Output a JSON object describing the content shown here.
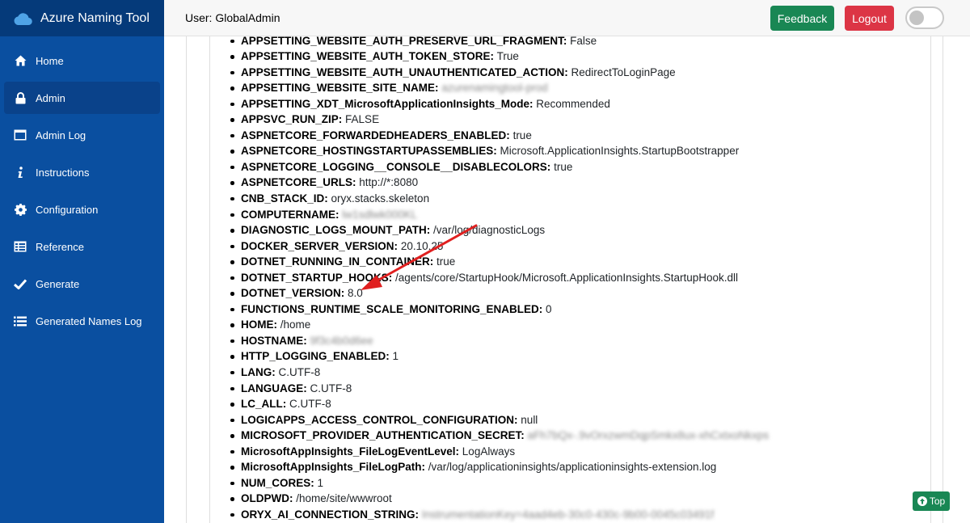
{
  "app": {
    "title": "Azure Naming Tool"
  },
  "sidebar": {
    "items": [
      {
        "label": "Home",
        "icon": "home-icon"
      },
      {
        "label": "Admin",
        "icon": "lock-icon",
        "active": true
      },
      {
        "label": "Admin Log",
        "icon": "window-icon"
      },
      {
        "label": "Instructions",
        "icon": "info-icon"
      },
      {
        "label": "Configuration",
        "icon": "gear-icon"
      },
      {
        "label": "Reference",
        "icon": "table-icon"
      },
      {
        "label": "Generate",
        "icon": "check-icon"
      },
      {
        "label": "Generated Names Log",
        "icon": "list-icon"
      }
    ]
  },
  "header": {
    "user": "User: GlobalAdmin",
    "feedback_label": "Feedback",
    "logout_label": "Logout"
  },
  "env": [
    {
      "key": "APPSETTING_WEBSITE_AUTH_PRESERVE_URL_FRAGMENT:",
      "value": "False"
    },
    {
      "key": "APPSETTING_WEBSITE_AUTH_TOKEN_STORE:",
      "value": "True"
    },
    {
      "key": "APPSETTING_WEBSITE_AUTH_UNAUTHENTICATED_ACTION:",
      "value": "RedirectToLoginPage"
    },
    {
      "key": "APPSETTING_WEBSITE_SITE_NAME:",
      "value": "azurenamingtool-prod",
      "blurred": true
    },
    {
      "key": "APPSETTING_XDT_MicrosoftApplicationInsights_Mode:",
      "value": "Recommended"
    },
    {
      "key": "APPSVC_RUN_ZIP:",
      "value": "FALSE"
    },
    {
      "key": "ASPNETCORE_FORWARDEDHEADERS_ENABLED:",
      "value": "true"
    },
    {
      "key": "ASPNETCORE_HOSTINGSTARTUPASSEMBLIES:",
      "value": "Microsoft.ApplicationInsights.StartupBootstrapper"
    },
    {
      "key": "ASPNETCORE_LOGGING__CONSOLE__DISABLECOLORS:",
      "value": "true"
    },
    {
      "key": "ASPNETCORE_URLS:",
      "value": "http://*:8080"
    },
    {
      "key": "CNB_STACK_ID:",
      "value": "oryx.stacks.skeleton"
    },
    {
      "key": "COMPUTERNAME:",
      "value": "lw1sdlwk000KL",
      "blurred": true
    },
    {
      "key": "DIAGNOSTIC_LOGS_MOUNT_PATH:",
      "value": "/var/log/diagnosticLogs"
    },
    {
      "key": "DOCKER_SERVER_VERSION:",
      "value": "20.10.25"
    },
    {
      "key": "DOTNET_RUNNING_IN_CONTAINER:",
      "value": "true"
    },
    {
      "key": "DOTNET_STARTUP_HOOKS:",
      "value": "/agents/core/StartupHook/Microsoft.ApplicationInsights.StartupHook.dll"
    },
    {
      "key": "DOTNET_VERSION:",
      "value": "8.0"
    },
    {
      "key": "FUNCTIONS_RUNTIME_SCALE_MONITORING_ENABLED:",
      "value": "0"
    },
    {
      "key": "HOME:",
      "value": "/home"
    },
    {
      "key": "HOSTNAME:",
      "value": "9f3c4b0d6ee",
      "blurred": true
    },
    {
      "key": "HTTP_LOGGING_ENABLED:",
      "value": "1"
    },
    {
      "key": "LANG:",
      "value": "C.UTF-8"
    },
    {
      "key": "LANGUAGE:",
      "value": "C.UTF-8"
    },
    {
      "key": "LC_ALL:",
      "value": "C.UTF-8"
    },
    {
      "key": "LOGICAPPS_ACCESS_CONTROL_CONFIGURATION:",
      "value": "null"
    },
    {
      "key": "MICROSOFT_PROVIDER_AUTHENTICATION_SECRET:",
      "value": "aFh7bQx-.9vOrxzwmDqpSmkx8ux-xhCxtxoNkxps",
      "blurred": true
    },
    {
      "key": "MicrosoftAppInsights_FileLogEventLevel:",
      "value": "LogAlways"
    },
    {
      "key": "MicrosoftAppInsights_FileLogPath:",
      "value": "/var/log/applicationinsights/applicationinsights-extension.log"
    },
    {
      "key": "NUM_CORES:",
      "value": "1"
    },
    {
      "key": "OLDPWD:",
      "value": "/home/site/wwwroot"
    },
    {
      "key": "ORYX_AI_CONNECTION_STRING:",
      "value": "InstrumentationKey=4aad4eb-30c0-430c-9b00-0045c03491f",
      "blurred": true
    }
  ],
  "scroll_top_label": "Top",
  "colors": {
    "sidebar": "#0a4fa0",
    "sidebar_brand": "#053a7a",
    "feedback": "#198754",
    "logout": "#dc3545",
    "arrow": "#e02020"
  }
}
